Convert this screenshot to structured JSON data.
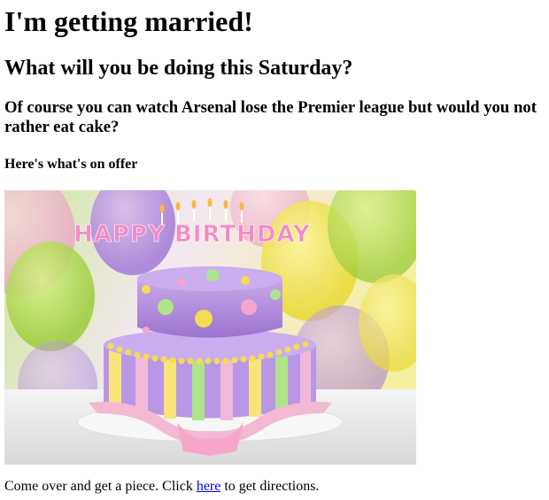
{
  "page": {
    "title": "I'm getting married!",
    "subtitle": "What will you be doing this Saturday?",
    "pitch": "Of course you can watch Arsenal lose the Premier league but would you not rather eat cake?",
    "offer_heading": "Here's what's on offer"
  },
  "image": {
    "subject": "birthday cake photo",
    "cake_text": "HAPPY BIRTHDAY"
  },
  "footer": {
    "text_before": "Come over and get a piece. Click ",
    "link_label": "here",
    "text_after": " to get directions."
  },
  "colors": {
    "link": "#0000ee",
    "text": "#000000",
    "background": "#ffffff"
  }
}
